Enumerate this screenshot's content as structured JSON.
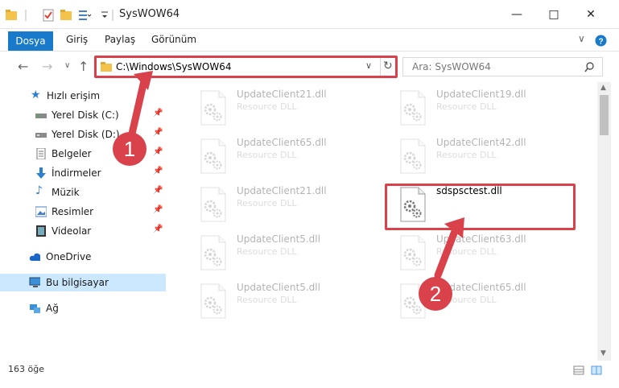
{
  "window": {
    "title": "SysWOW64",
    "minimize_icon": "minimize-icon",
    "maximize_icon": "maximize-icon",
    "close_icon": "close-icon"
  },
  "ribbon": {
    "tabs": [
      {
        "label": "Dosya"
      },
      {
        "label": "Giriş"
      },
      {
        "label": "Paylaş"
      },
      {
        "label": "Görünüm"
      }
    ]
  },
  "address": {
    "path": "C:\\Windows\\SysWOW64",
    "search_placeholder": "Ara: SysWOW64"
  },
  "sidebar": {
    "items": [
      {
        "label": "Hızlı erişim",
        "icon": "star-icon"
      },
      {
        "label": "Yerel Disk (C:)",
        "icon": "drive-icon",
        "pinned": true
      },
      {
        "label": "Yerel Disk (D:)",
        "icon": "drive-icon",
        "pinned": true
      },
      {
        "label": "Belgeler",
        "icon": "document-icon",
        "pinned": true
      },
      {
        "label": "İndirmeler",
        "icon": "download-icon",
        "pinned": true
      },
      {
        "label": "Müzik",
        "icon": "music-icon",
        "pinned": true
      },
      {
        "label": "Resimler",
        "icon": "pictures-icon",
        "pinned": true
      },
      {
        "label": "Videolar",
        "icon": "video-icon",
        "pinned": true
      },
      {
        "label": "OneDrive",
        "icon": "cloud-icon"
      },
      {
        "label": "Bu bilgisayar",
        "icon": "computer-icon",
        "selected": true
      },
      {
        "label": "Ağ",
        "icon": "network-icon"
      }
    ]
  },
  "files": [
    {
      "name": "UpdateClient21.dll",
      "type": "Resource DLL",
      "faded": true
    },
    {
      "name": "UpdateClient19.dll",
      "type": "Resource DLL",
      "faded": true
    },
    {
      "name": "UpdateClient65.dll",
      "type": "Resource DLL",
      "faded": true
    },
    {
      "name": "UpdateClient42.dll",
      "type": "Resource DLL",
      "faded": true
    },
    {
      "name": "UpdateClient21.dll",
      "type": "Resource DLL",
      "faded": true
    },
    {
      "name": "sdspsctest.dll",
      "type": "",
      "faded": false
    },
    {
      "name": "UpdateClient5.dll",
      "type": "Resource DLL",
      "faded": true
    },
    {
      "name": "UpdateClient63.dll",
      "type": "Resource DLL",
      "faded": true
    },
    {
      "name": "UpdateClient5.dll",
      "type": "Resource DLL",
      "faded": true
    },
    {
      "name": "UpdateClient65.dll",
      "type": "Resource DLL",
      "faded": true
    }
  ],
  "annotations": {
    "step1": "1",
    "step2": "2",
    "highlight_color": "#d9414b"
  },
  "status": {
    "count": "163 öğe"
  }
}
